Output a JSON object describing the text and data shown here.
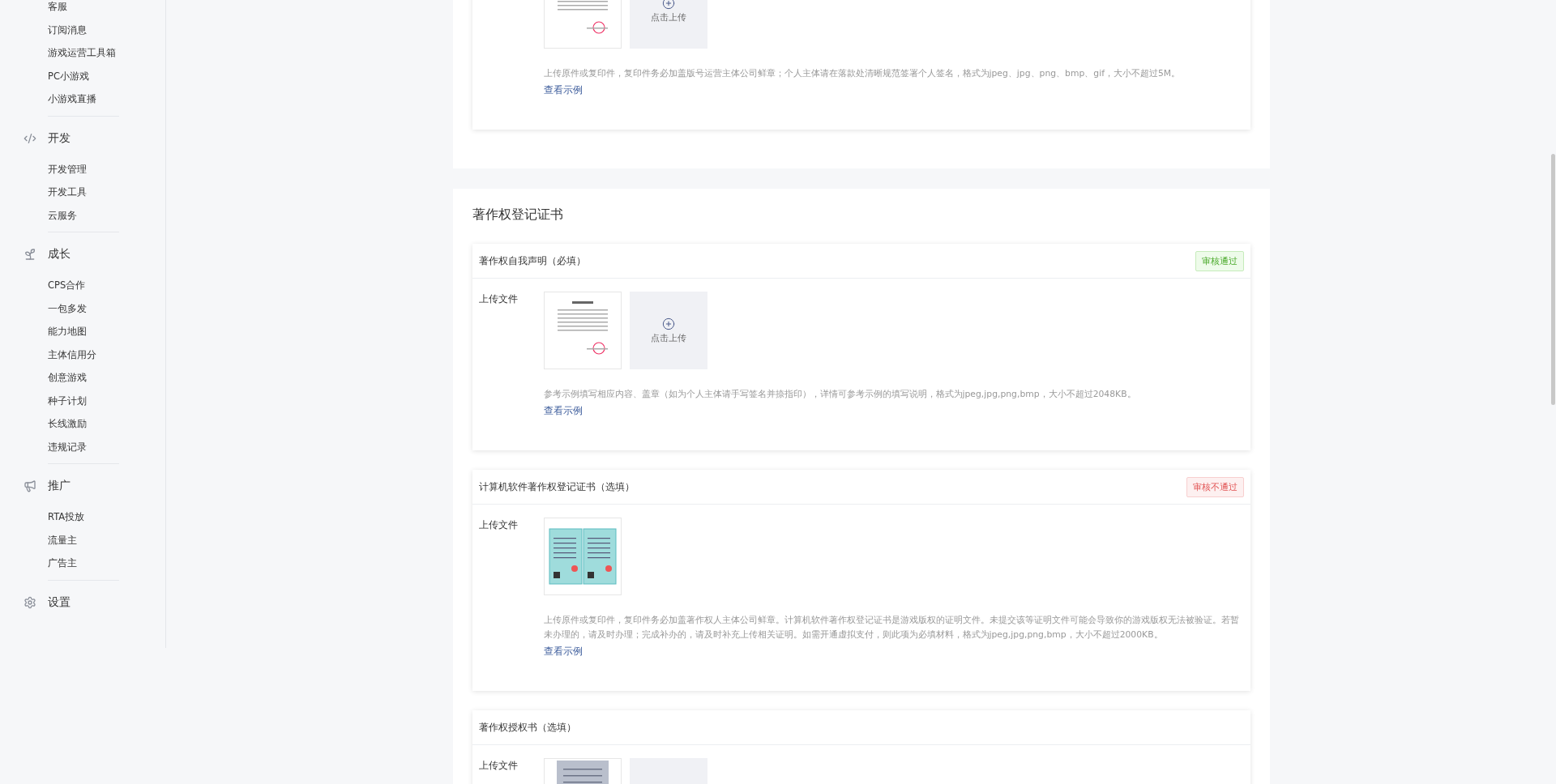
{
  "sidebar": {
    "sections": [
      {
        "items": [
          "客服",
          "订阅消息",
          "游戏运营工具箱",
          "PC小游戏",
          "小游戏直播"
        ]
      },
      {
        "title": "开发",
        "items": [
          "开发管理",
          "开发工具",
          "云服务"
        ]
      },
      {
        "title": "成长",
        "items": [
          "CPS合作",
          "一包多发",
          "能力地图",
          "主体信用分",
          "创意游戏",
          "种子计划",
          "长线激励",
          "违规记录"
        ]
      },
      {
        "title": "推广",
        "items": [
          "RTA投放",
          "流量主",
          "广告主"
        ]
      },
      {
        "title": "设置"
      }
    ]
  },
  "top_card": {
    "files": [
      {
        "kind": "document"
      }
    ],
    "upload_slot": true,
    "upload_label": "点击上传",
    "hint": "上传原件或复印件，复印件务必加盖版号运营主体公司鲜章；个人主体请在落款处清晰规范签署个人签名，格式为jpeg、jpg、png、bmp、gif，大小不超过5M。",
    "link": "查看示例"
  },
  "section": {
    "title": "著作权登记证书",
    "cards": [
      {
        "title": "著作权自我声明（必填）",
        "status": {
          "kind": "approved",
          "label": "审核通过"
        },
        "field_label": "上传文件",
        "files": [
          {
            "kind": "document"
          }
        ],
        "upload_slot": true,
        "upload_label": "点击上传",
        "hint": "参考示例填写相应内容、盖章（如为个人主体请手写签名并捺指印），详情可参考示例的填写说明，格式为jpeg,jpg,png,bmp，大小不超过2048KB。",
        "link": "查看示例"
      },
      {
        "title": "计算机软件著作权登记证书（选填）",
        "status": {
          "kind": "rejected",
          "label": "审核不通过"
        },
        "field_label": "上传文件",
        "files": [
          {
            "kind": "certificate"
          }
        ],
        "upload_slot": false,
        "hint": "上传原件或复印件，复印件务必加盖著作权人主体公司鲜章。计算机软件著作权登记证书是游戏版权的证明文件。未提交该等证明文件可能会导致你的游戏版权无法被验证。若暂未办理的，请及时办理；完成补办的，请及时补充上传相关证明。如需开通虚拟支付，则此项为必填材料，格式为jpeg,jpg,png,bmp，大小不超过2000KB。",
        "link": "查看示例"
      },
      {
        "title": "著作权授权书（选填）",
        "field_label": "上传文件",
        "files": [
          {
            "kind": "scan"
          }
        ],
        "upload_slot": true
      }
    ]
  }
}
